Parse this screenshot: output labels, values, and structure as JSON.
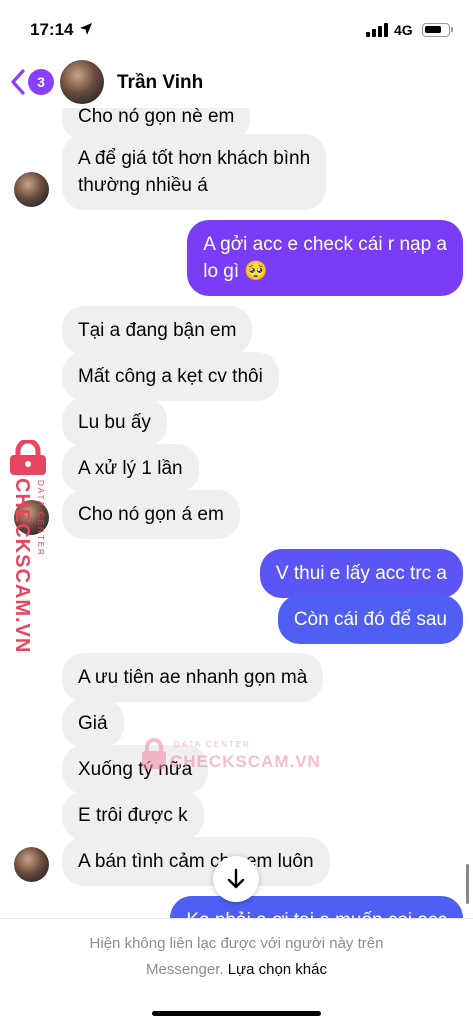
{
  "status_bar": {
    "time": "17:14",
    "network": "4G"
  },
  "header": {
    "unread_count": "3",
    "contact_name": "Trần Vinh"
  },
  "messages": [
    {
      "side": "in",
      "text": "Cho nó gọn nè em"
    },
    {
      "side": "in",
      "text_lines": [
        "A để giá tốt hơn khách bình",
        "thường nhiều á"
      ]
    },
    {
      "side": "out",
      "text_lines": [
        "A gởi acc e check cái r nạp a",
        "lo gì 🥺"
      ]
    },
    {
      "side": "in",
      "text": "Tại a đang bận em"
    },
    {
      "side": "in",
      "text": "Mất công a kẹt cv thôi"
    },
    {
      "side": "in",
      "text": "Lu bu ấy"
    },
    {
      "side": "in",
      "text": "A xử lý 1 lần"
    },
    {
      "side": "in",
      "text": "Cho nó gọn á em"
    },
    {
      "side": "out",
      "text": "V thui e lấy acc trc a"
    },
    {
      "side": "out",
      "text": "Còn cái đó để sau"
    },
    {
      "side": "in",
      "text": "A ưu tiên ae nhanh gọn mà"
    },
    {
      "side": "in",
      "text": "Giá"
    },
    {
      "side": "in",
      "text": "Xuống tý nữa"
    },
    {
      "side": "in",
      "text": "E trôi được k"
    },
    {
      "side": "in",
      "text": "A bán tình cảm cho em luôn"
    },
    {
      "side": "out",
      "text": "Ko phải a ơi tại e muốn coi acc"
    }
  ],
  "footer": {
    "notice_line1": "Hiện không liên lạc được với người này trên",
    "notice_line2": "Messenger.",
    "link": "Lựa chọn khác"
  },
  "watermark": {
    "main": "CHECKSCAM.VN",
    "sub": "DATA CENTER"
  },
  "colors": {
    "accent": "#8a3ffc",
    "out_bubble_purple": "#7a3df5",
    "out_bubble_blue": "#4f5ef3",
    "in_bubble": "#efefef",
    "watermark": "#e8455f"
  }
}
